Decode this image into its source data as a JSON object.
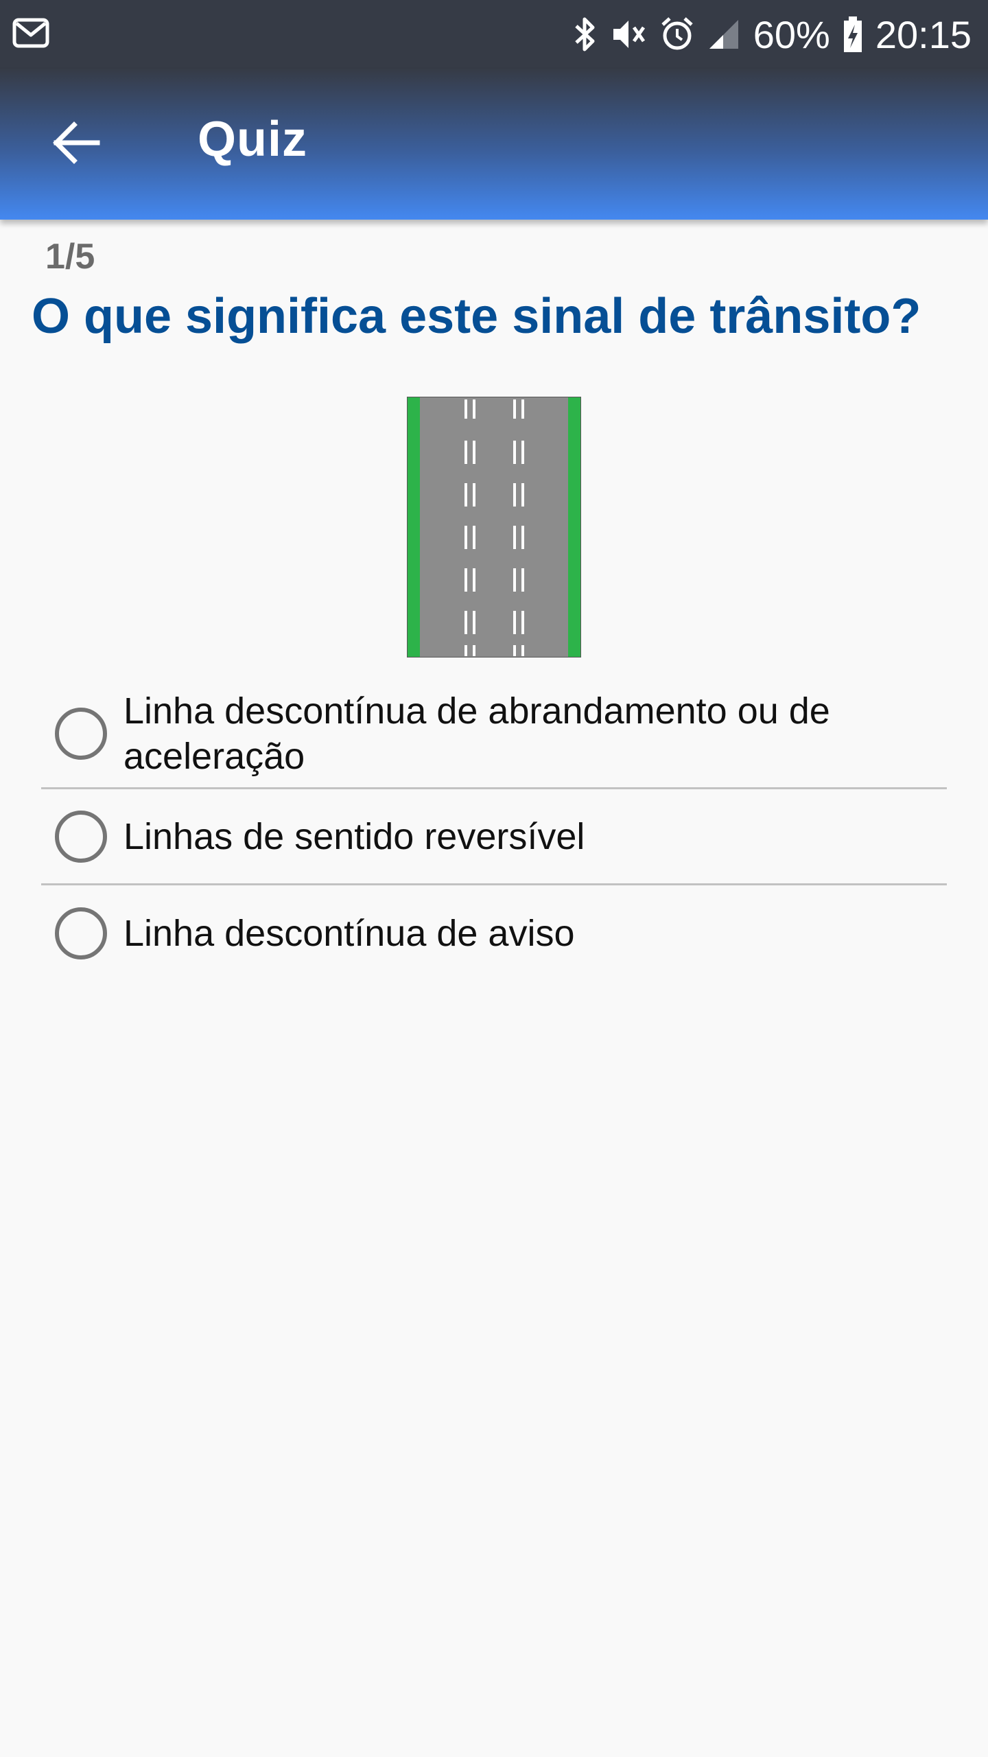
{
  "status_bar": {
    "battery": "60%",
    "time": "20:15",
    "icons": [
      "mail-icon",
      "bluetooth-icon",
      "vibrate-mute-icon",
      "alarm-icon",
      "signal-icon",
      "battery-charging-icon"
    ]
  },
  "app_bar": {
    "title": "Quiz",
    "back_icon": "arrow-back-icon"
  },
  "quiz": {
    "progress": "1/5",
    "question": "O que significa este sinal de trânsito?",
    "options": [
      {
        "label": "Linha descontínua de abrandamento ou de aceleração",
        "selected": false
      },
      {
        "label": "Linhas de sentido reversível",
        "selected": false
      },
      {
        "label": "Linha descontínua de aviso",
        "selected": false
      }
    ]
  },
  "colors": {
    "accent": "#064f95",
    "app_bar_bottom": "#4488f0",
    "status_bar": "#363b46",
    "road": "#8c8c8c",
    "road_edge": "#2db34a"
  }
}
